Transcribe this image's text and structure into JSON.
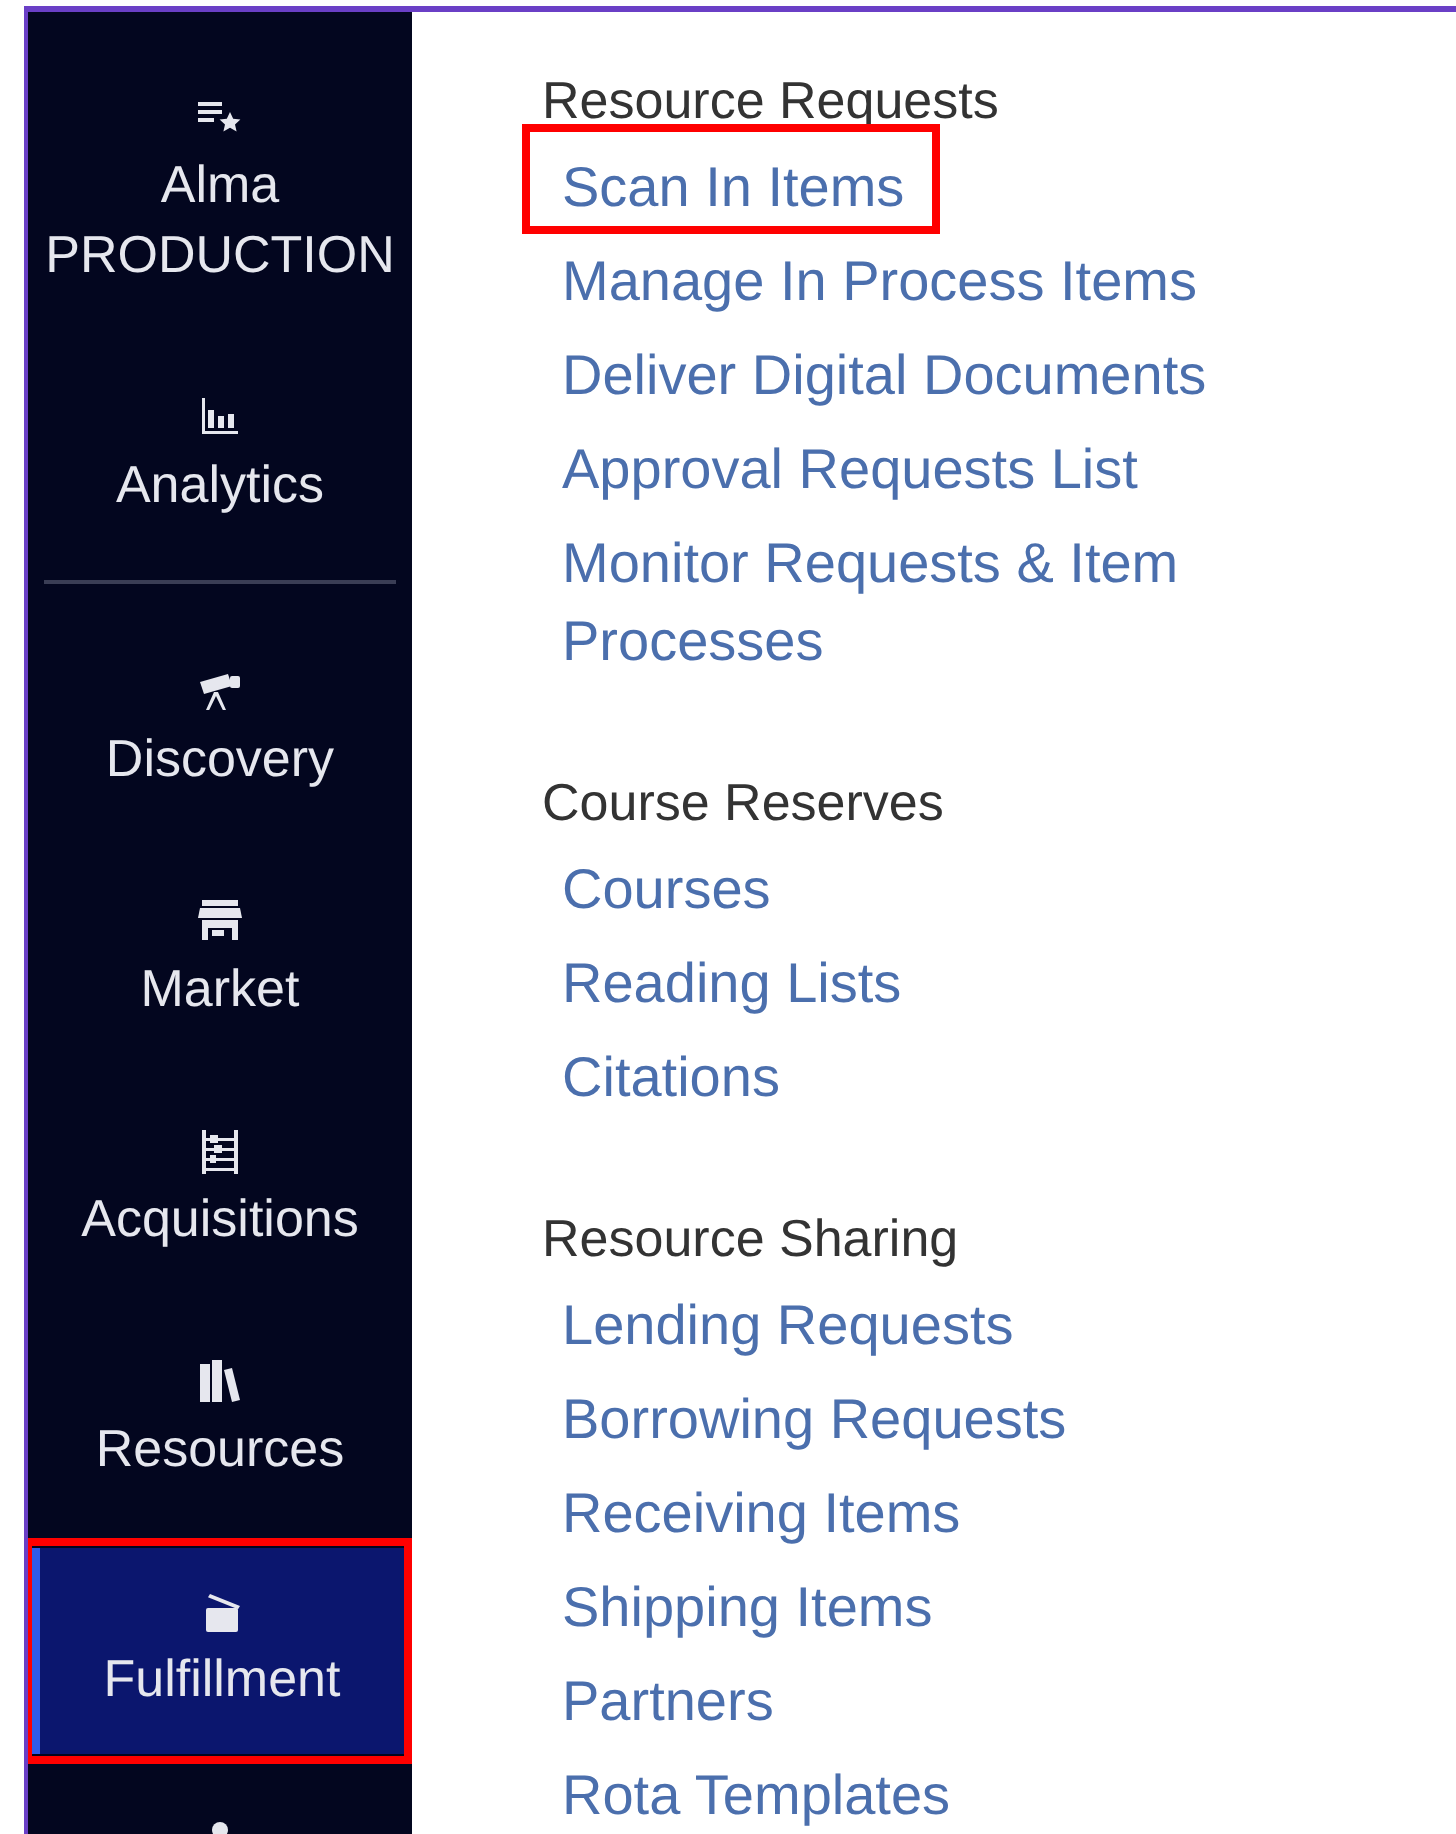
{
  "sidebar": {
    "groups": [
      [
        {
          "label": "Alma PRODUCTION",
          "selected": false,
          "highlighted": false
        },
        {
          "label": "Analytics",
          "selected": false,
          "highlighted": false
        }
      ],
      [
        {
          "label": "Discovery",
          "selected": false,
          "highlighted": false
        },
        {
          "label": "Market",
          "selected": false,
          "highlighted": false
        },
        {
          "label": "Acquisitions",
          "selected": false,
          "highlighted": false
        },
        {
          "label": "Resources",
          "selected": false,
          "highlighted": false
        },
        {
          "label": "Fulfillment",
          "selected": true,
          "highlighted": true
        },
        {
          "selected": false
        }
      ]
    ]
  },
  "sections": [
    {
      "title": "Resource Requests",
      "links": [
        {
          "label": "Scan In Items",
          "highlighted": true
        },
        {
          "label": "Manage In Process Items",
          "highlighted": false
        },
        {
          "label": "Deliver Digital Documents",
          "highlighted": false
        },
        {
          "label": "Approval Requests List",
          "highlighted": false
        },
        {
          "label": "Monitor Requests & Item Processes",
          "highlighted": false
        }
      ]
    },
    {
      "title": "Course Reserves",
      "links": [
        {
          "label": "Courses",
          "highlighted": false
        },
        {
          "label": "Reading Lists",
          "highlighted": false
        },
        {
          "label": "Citations",
          "highlighted": false
        }
      ]
    },
    {
      "title": "Resource Sharing",
      "links": [
        {
          "label": "Lending Requests",
          "highlighted": false
        },
        {
          "label": "Borrowing Requests",
          "highlighted": false
        },
        {
          "label": "Receiving Items",
          "highlighted": false
        },
        {
          "label": "Shipping Items",
          "highlighted": false
        },
        {
          "label": "Partners",
          "highlighted": false
        },
        {
          "label": "Rota Templates",
          "highlighted": false
        }
      ]
    }
  ]
}
